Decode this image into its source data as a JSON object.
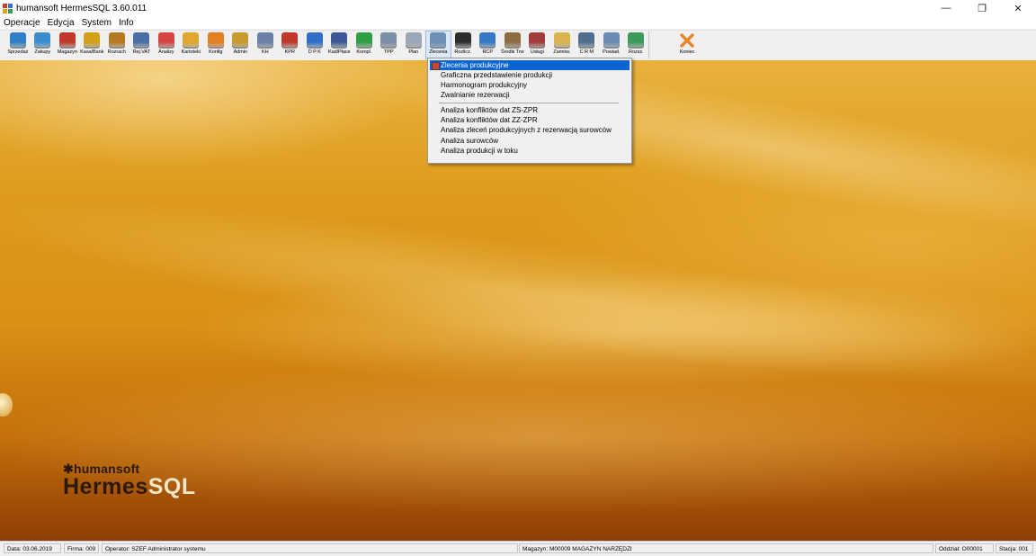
{
  "window": {
    "title": "humansoft HermesSQL 3.60.011",
    "controls": {
      "minimize": "—",
      "restore": "❐",
      "close": "✕"
    }
  },
  "menubar": [
    "Operacje",
    "Edycja",
    "System",
    "Info"
  ],
  "toolbar": {
    "buttons": [
      {
        "label": "Sprzedaż",
        "icon": "sales-icon",
        "color": "#2f7fc9"
      },
      {
        "label": "Zakupy",
        "icon": "cart-icon",
        "color": "#3a8ed0"
      },
      {
        "label": "Magazyn",
        "icon": "forklift-icon",
        "color": "#c0392b"
      },
      {
        "label": "Kasa/Bank",
        "icon": "money-bag-icon",
        "color": "#d4a017"
      },
      {
        "label": "Rozrach",
        "icon": "abacus-icon",
        "color": "#b7791f"
      },
      {
        "label": "Rej.VAT",
        "icon": "vat-icon",
        "color": "#4a6fa5"
      },
      {
        "label": "Analizy",
        "icon": "pie-chart-icon",
        "color": "#d64541"
      },
      {
        "label": "Kartoteki",
        "icon": "folder-icon",
        "color": "#e0a82e"
      },
      {
        "label": "Konfig",
        "icon": "gear-icon",
        "color": "#e67e22"
      },
      {
        "label": "Admin",
        "icon": "admin-icon",
        "color": "#c99a2e"
      },
      {
        "label": "KH",
        "icon": "kh-icon",
        "color": "#6b7fa8"
      },
      {
        "label": "KPR",
        "icon": "kpr-icon",
        "color": "#c0392b"
      },
      {
        "label": "D P K",
        "icon": "puzzle-icon",
        "color": "#2f6fc9"
      },
      {
        "label": "Kad/Płace",
        "icon": "people-icon",
        "color": "#3b5998"
      },
      {
        "label": "Kompl.",
        "icon": "box-icon",
        "color": "#2ea043"
      },
      {
        "label": "TPP",
        "icon": "tpp-icon",
        "color": "#7d8ea8"
      },
      {
        "label": "Plan",
        "icon": "plan-icon",
        "color": "#9aa7b8"
      },
      {
        "label": "Zlecenia",
        "icon": "production-icon",
        "color": "#6c8fb8"
      },
      {
        "label": "Rozlicz.",
        "icon": "checkered-flag-icon",
        "color": "#2d2d2d"
      },
      {
        "label": "RCP",
        "icon": "clock-icon",
        "color": "#3478c6"
      },
      {
        "label": "Środki Trw",
        "icon": "fixed-assets-icon",
        "color": "#8c6d3f"
      },
      {
        "label": "Usługi",
        "icon": "worker-icon",
        "color": "#a33b3b"
      },
      {
        "label": "Zamów.",
        "icon": "clipboard-icon",
        "color": "#d9b44a"
      },
      {
        "label": "C R M",
        "icon": "crm-icon",
        "color": "#4f6d8f"
      },
      {
        "label": "Powiad.",
        "icon": "notify-icon",
        "color": "#6a8bb3"
      },
      {
        "label": "Rozsz.",
        "icon": "globe-icon",
        "color": "#3a9a5a"
      }
    ],
    "exit": {
      "label": "Koniec",
      "icon": "exit-x-icon",
      "color": "#e8872a"
    }
  },
  "dropdown": {
    "items": [
      "Zlecenia produkcyjne",
      "Graficzna przedstawienie produkcji",
      "Harmonogram produkcyjny",
      "Zwalnianie rezerwacji",
      "Analiza konfliktów dat ZS-ZPR",
      "Analiza konfliktów dat ZZ-ZPR",
      "Analiza zleceń produkcyjnych z rezerwacją surowców",
      "Analiza surowców",
      "Analiza produkcji w toku"
    ]
  },
  "brand": {
    "small": "humansoft",
    "big_a": "Hermes",
    "big_b": "SQL"
  },
  "statusbar": {
    "date": "Data: 03.06.2019",
    "firm": "Firma: 009",
    "operator": "Operator: SZEF Administrator systemu",
    "warehouse": "Magazyn: M00009 MAGAZYN NARZĘDZI",
    "branch": "Oddział: O00001",
    "station": "Stacja: 001"
  }
}
